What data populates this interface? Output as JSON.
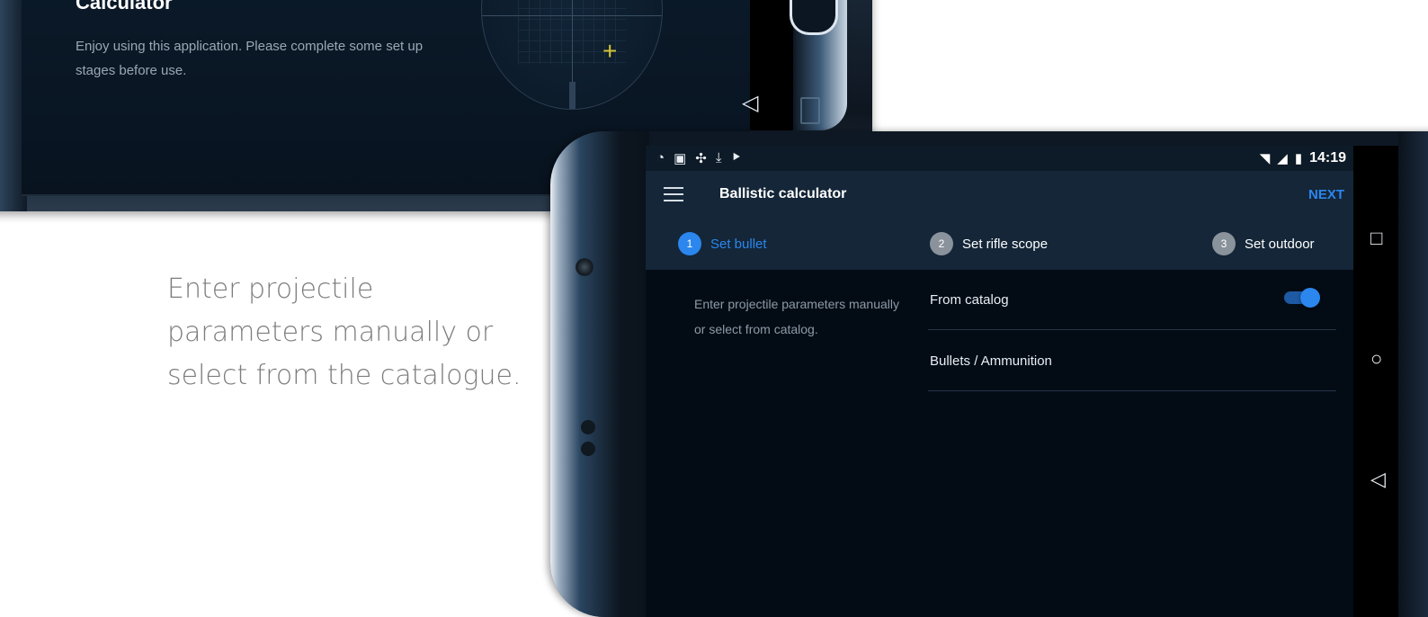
{
  "intro_screen": {
    "title": "Calculator",
    "description": "Enjoy using this application. Please complete some set up stages before use."
  },
  "caption": "Enter projectile parameters manually or select from the catalogue.",
  "status_bar": {
    "time": "14:19",
    "left_icons": [
      "wifi-question-icon",
      "image-icon",
      "pinwheel-icon",
      "download-icon",
      "play-flag-icon"
    ],
    "right_icons": [
      "wifi-icon",
      "signal-icon",
      "battery-icon"
    ]
  },
  "app_bar": {
    "title": "Ballistic calculator",
    "next_label": "NEXT"
  },
  "steps": [
    {
      "number": "1",
      "label": "Set bullet",
      "active": true
    },
    {
      "number": "2",
      "label": "Set rifle scope",
      "active": false
    },
    {
      "number": "3",
      "label": "Set outdoor",
      "active": false
    }
  ],
  "content": {
    "description": "Enter projectile parameters manually or select from catalog.",
    "from_catalog_label": "From catalog",
    "from_catalog_enabled": true,
    "bullets_label": "Bullets / Ammunition"
  },
  "colors": {
    "accent": "#2b86ee",
    "appbar": "#142638",
    "screen_bg": "#030c15",
    "inactive_step": "#8a929b"
  }
}
